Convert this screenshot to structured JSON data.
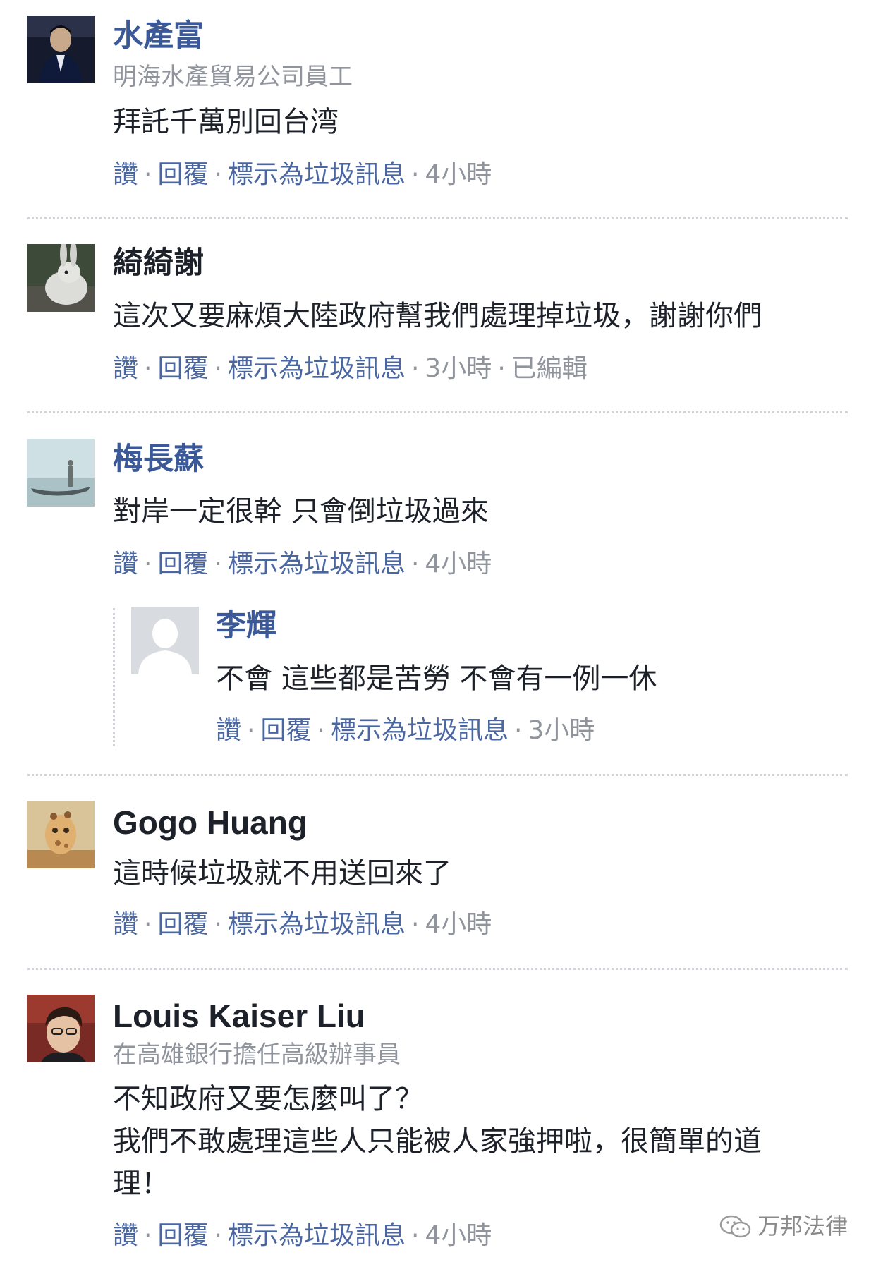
{
  "comments": [
    {
      "name": "水產富",
      "subtitle": "明海水產貿易公司員工",
      "text": [
        "拜託千萬別回台湾"
      ],
      "actions": {
        "like": "讚",
        "reply": "回覆",
        "spam": "標示為垃圾訊息",
        "time": "4小時",
        "edited": ""
      }
    },
    {
      "name": "綺綺謝",
      "subtitle": "",
      "text": [
        "這次又要麻煩大陸政府幫我們處理掉垃圾，謝謝你們"
      ],
      "actions": {
        "like": "讚",
        "reply": "回覆",
        "spam": "標示為垃圾訊息",
        "time": "3小時",
        "edited": "已編輯"
      }
    },
    {
      "name": "梅長蘇",
      "subtitle": "",
      "text": [
        "對岸一定很幹 只會倒垃圾過來"
      ],
      "actions": {
        "like": "讚",
        "reply": "回覆",
        "spam": "標示為垃圾訊息",
        "time": "4小時",
        "edited": ""
      }
    },
    {
      "name": "李輝",
      "subtitle": "",
      "text": [
        "不會 這些都是苦勞 不會有一例一休"
      ],
      "actions": {
        "like": "讚",
        "reply": "回覆",
        "spam": "標示為垃圾訊息",
        "time": "3小時",
        "edited": ""
      }
    },
    {
      "name": "Gogo Huang",
      "subtitle": "",
      "text": [
        "這時候垃圾就不用送回來了"
      ],
      "actions": {
        "like": "讚",
        "reply": "回覆",
        "spam": "標示為垃圾訊息",
        "time": "4小時",
        "edited": ""
      }
    },
    {
      "name": "Louis Kaiser Liu",
      "subtitle": "在高雄銀行擔任高級辦事員",
      "text": [
        "不知政府又要怎麼叫了？",
        "我們不敢處理這些人只能被人家強押啦，很簡單的道",
        "理！"
      ],
      "actions": {
        "like": "讚",
        "reply": "回覆",
        "spam": "標示為垃圾訊息",
        "time": "4小時",
        "edited": ""
      }
    }
  ],
  "separator": "·",
  "watermark": "万邦法律",
  "colors": {
    "link": "#3b5998",
    "action": "#4b67a1",
    "meta": "#90949c",
    "text": "#1d2129"
  }
}
